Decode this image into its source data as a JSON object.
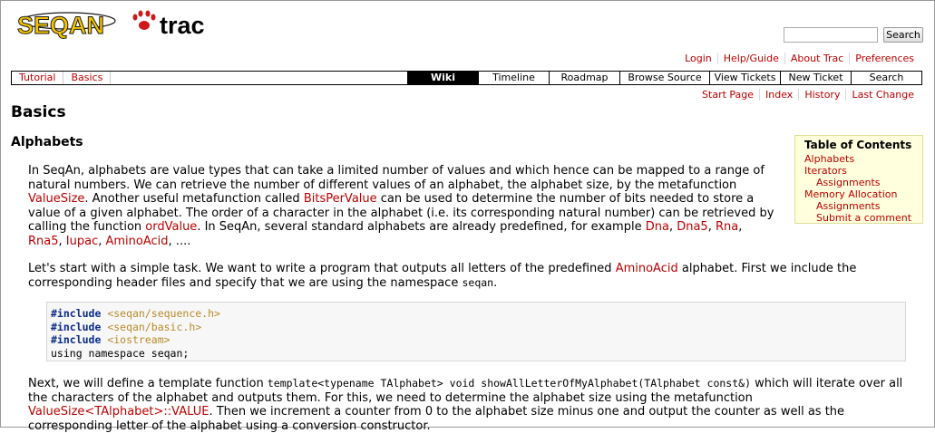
{
  "logo": {
    "left": "SEQAN",
    "right": "trac"
  },
  "search": {
    "button": "Search"
  },
  "metanav": [
    "Login",
    "Help/Guide",
    "About Trac",
    "Preferences"
  ],
  "ctx_links": [
    "Tutorial",
    "Basics"
  ],
  "tabs": [
    "Wiki",
    "Timeline",
    "Roadmap",
    "Browse Source",
    "View Tickets",
    "New Ticket",
    "Search"
  ],
  "ctxnav": [
    "Start Page",
    "Index",
    "History",
    "Last Change"
  ],
  "page": {
    "title": "Basics",
    "section": "Alphabets"
  },
  "toc": {
    "title": "Table of Contents",
    "items": [
      "Alphabets",
      "Iterators",
      "Assignments",
      "Memory Allocation",
      "Assignments",
      "Submit a comment"
    ]
  },
  "p1": {
    "t1": "In SeqAn, alphabets are value types that can take a limited number of values and which hence can be mapped to a range of natural numbers. We can retrieve the number of different values of an alphabet, the alphabet size, by the metafunction ",
    "l1": "ValueSize",
    "t2": ". Another useful metafunction called ",
    "l2": "BitsPerValue",
    "t3": " can be used to determine the number of bits needed to store a value of a given alphabet. The order of a character in the alphabet (i.e. its corresponding natural number) can be retrieved by calling the function ",
    "l3": "ordValue",
    "t4": ". In SeqAn, several standard alphabets are already predefined, for example ",
    "l4": "Dna",
    "s1": ", ",
    "l5": "Dna5",
    "s2": ", ",
    "l6": "Rna",
    "s3": ", ",
    "l7": "Rna5",
    "s4": ", ",
    "l8": "Iupac",
    "s5": ", ",
    "l9": "AminoAcid",
    "t5": ", ...."
  },
  "p2": {
    "t1": "Let's start with a simple task. We want to write a program that outputs all letters of the predefined ",
    "l1": "AminoAcid",
    "t2": " alphabet. First we include the corresponding header files and specify that we are using the namespace ",
    "c1": "seqan",
    "t3": "."
  },
  "code": [
    {
      "kw": "#include",
      "str": " <seqan/sequence.h>"
    },
    {
      "kw": "#include",
      "str": " <seqan/basic.h>"
    },
    {
      "kw": "#include",
      "str": " <iostream>"
    },
    {
      "plain": "using namespace seqan;"
    }
  ],
  "p3": {
    "t1": "Next, we will define a template function ",
    "c1": "template<typename TAlphabet> void showAllLetterOfMyAlphabet(TAlphabet const&)",
    "t2": " which will iterate over all the characters of the alphabet and outputs them. For this, we need to determine the alphabet size using the metafunction ",
    "l1": "ValueSize<TAlphabet>::VALUE",
    "t3": ". Then we increment a counter from 0 to the alphabet size minus one and output the counter as well as the corresponding letter of the alphabet using a conversion constructor."
  }
}
